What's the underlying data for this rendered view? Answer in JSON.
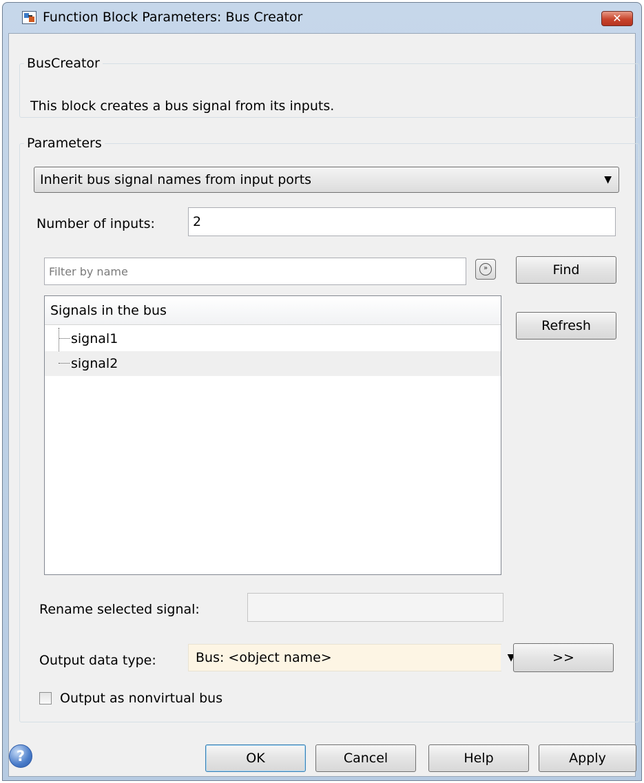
{
  "window": {
    "title": "Function Block Parameters: Bus Creator",
    "close_glyph": "✕"
  },
  "description_group": {
    "legend": "BusCreator",
    "text": "This block creates a bus signal from its inputs."
  },
  "parameters": {
    "legend": "Parameters",
    "naming_mode": "Inherit bus signal names from input ports",
    "number_of_inputs_label": "Number of inputs:",
    "number_of_inputs_value": "2",
    "filter_placeholder": "Filter by name",
    "find_label": "Find",
    "refresh_label": "Refresh",
    "signals_header": "Signals in the bus",
    "signals": [
      "signal1",
      "signal2"
    ],
    "rename_label": "Rename selected signal:",
    "rename_value": "",
    "output_type_label": "Output data type:",
    "output_type_value": "Bus: <object name>",
    "assistant_label": ">>",
    "nonvirtual_label": "Output as nonvirtual bus",
    "nonvirtual_checked": false
  },
  "buttons": {
    "ok": "OK",
    "cancel": "Cancel",
    "help": "Help",
    "apply": "Apply"
  },
  "icons": {
    "app": "simulink-block-icon",
    "options": "chevron-circle-icon",
    "help": "question-mark-icon"
  }
}
